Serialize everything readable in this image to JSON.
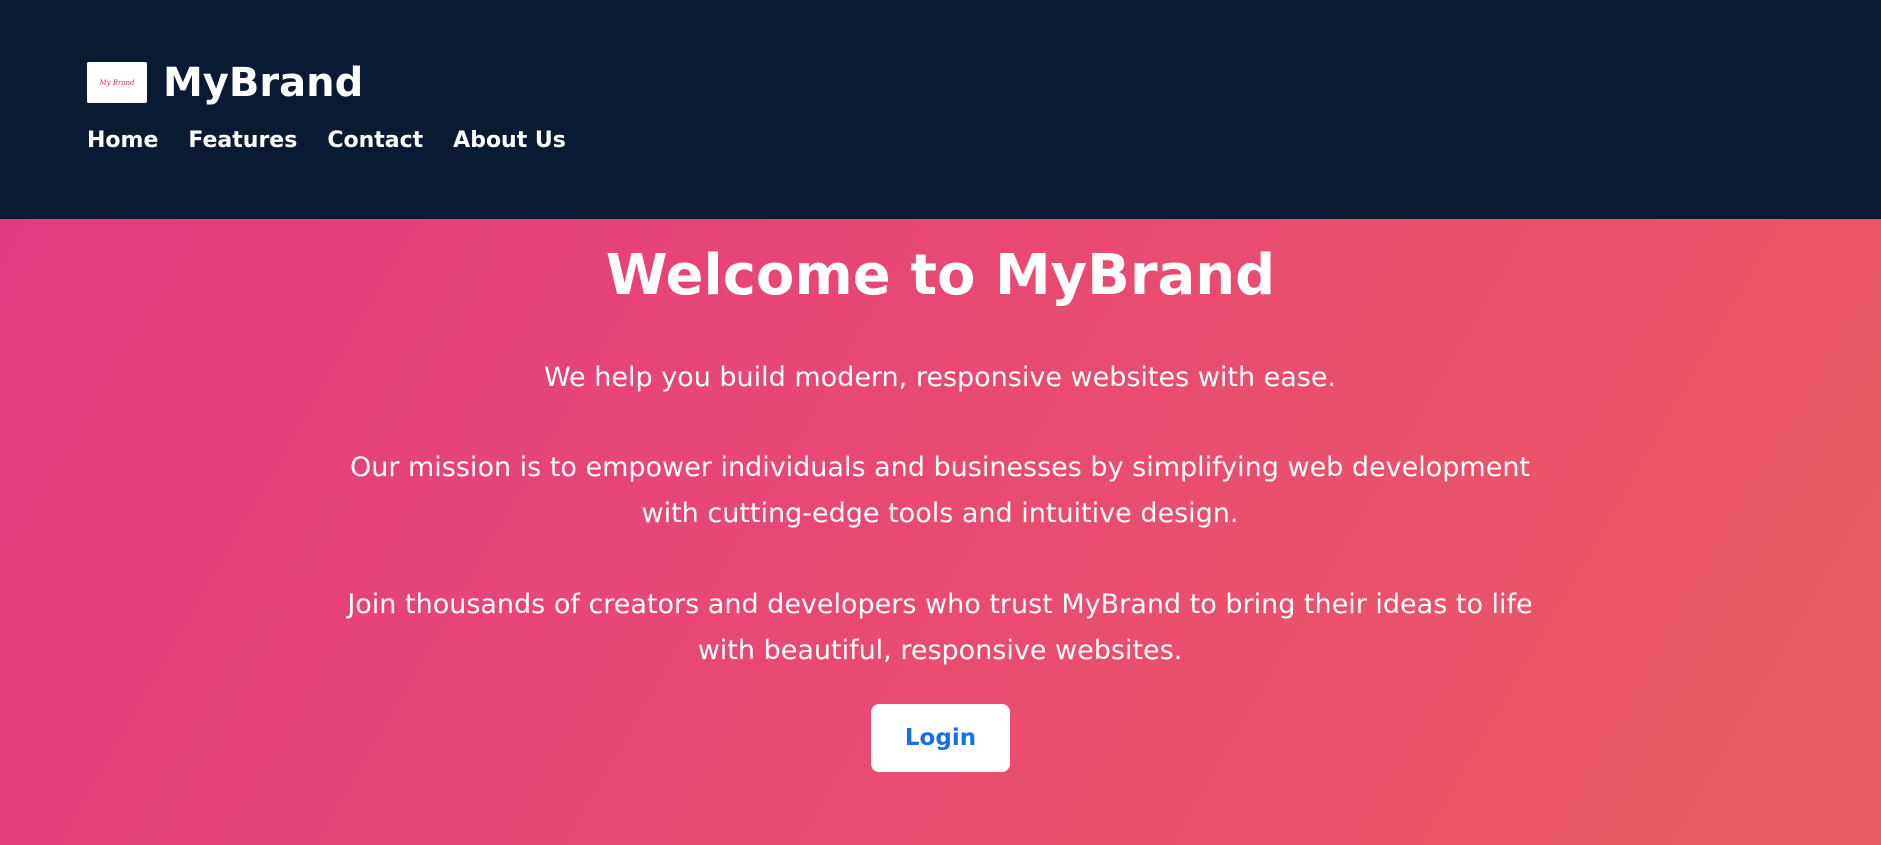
{
  "header": {
    "brand_name": "MyBrand",
    "logo_icon": "mybrand-logo",
    "nav": [
      {
        "label": "Home"
      },
      {
        "label": "Features"
      },
      {
        "label": "Contact"
      },
      {
        "label": "About Us"
      }
    ]
  },
  "hero": {
    "title": "Welcome to MyBrand",
    "paragraphs": [
      "We help you build modern, responsive websites with ease.",
      "Our mission is to empower individuals and businesses by simplifying web development with cutting-edge tools and intuitive design.",
      "Join thousands of creators and developers who trust MyBrand to bring their ideas to life with beautiful, responsive websites."
    ],
    "login_label": "Login"
  },
  "colors": {
    "header_bg": "#0b1a33",
    "hero_gradient_start": "#e33b80",
    "hero_gradient_end": "#eb5c62",
    "button_text": "#1a6fe0"
  }
}
